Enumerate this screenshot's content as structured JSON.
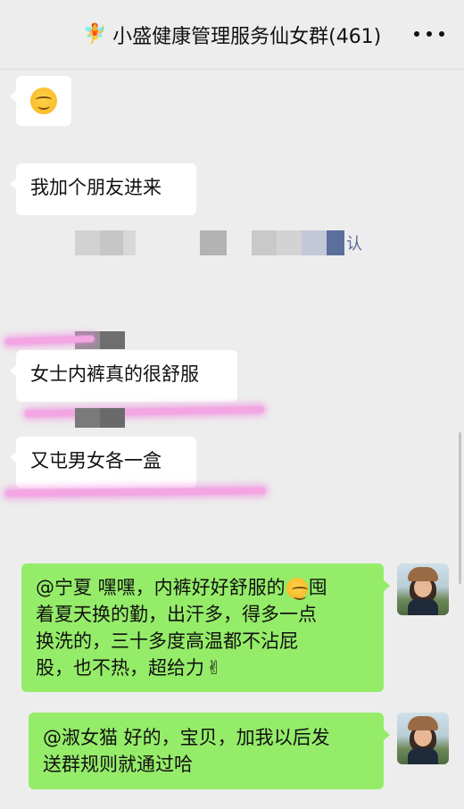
{
  "header": {
    "title": "小盛健康管理服务仙女群(461)",
    "title_icon": "fairy-emoji",
    "menu_icon": "more-icon"
  },
  "messages": {
    "m1": {
      "emoji": "smiling-face-emoji"
    },
    "m2": {
      "text": "我加个朋友进来"
    },
    "system": {
      "tail": "认"
    },
    "m3": {
      "text": "女士内裤真的很舒服"
    },
    "m4": {
      "text": "又屯男女各一盒"
    },
    "m5": {
      "line1_a": "@宁夏 嘿嘿，内裤好好舒服的",
      "line1_b": "囤",
      "line2": "着夏天换的勤，出汗多，得多一点",
      "line3": "换洗的，三十多度高温都不沾屁",
      "line4": "股，也不热，超给力"
    },
    "m6": {
      "line1": "@淑女猫 好的，宝贝，加我以后发",
      "line2": "送群规则就通过哈"
    }
  },
  "colors": {
    "background": "#ededed",
    "bubble_white": "#ffffff",
    "bubble_green": "#95ec69",
    "highlight_pink": "#f3a6e3",
    "link_blue": "#576b95"
  }
}
